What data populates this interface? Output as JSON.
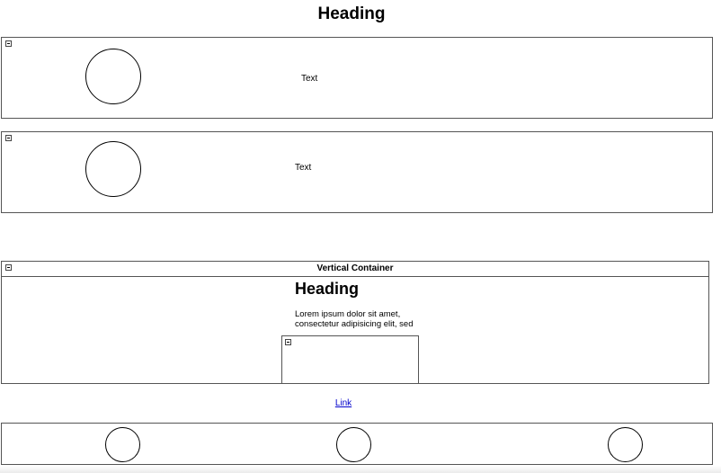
{
  "main_heading": "Heading",
  "panel1": {
    "text": "Text"
  },
  "panel2": {
    "text": "Text"
  },
  "vertical_container": {
    "title": "Vertical Container",
    "heading": "Heading",
    "paragraph": "Lorem ipsum dolor sit amet, consectetur adipisicing elit, sed"
  },
  "link": {
    "label": "Link"
  }
}
